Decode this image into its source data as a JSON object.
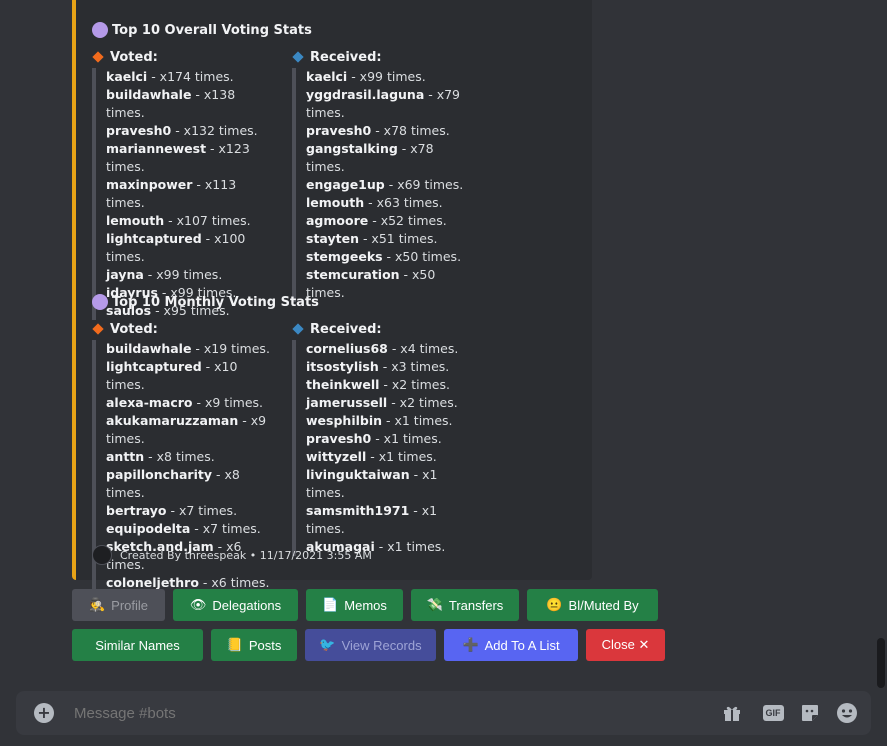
{
  "overall": {
    "title": "Top 10 Overall Voting Stats",
    "voted_label": "Voted:",
    "received_label": "Received:",
    "voted": [
      {
        "name": "kaelci",
        "count": " - x174 times."
      },
      {
        "name": "buildawhale",
        "count": " - x138 times."
      },
      {
        "name": "pravesh0",
        "count": " - x132 times."
      },
      {
        "name": "mariannewest",
        "count": " - x123 times."
      },
      {
        "name": "maxinpower",
        "count": " - x113 times."
      },
      {
        "name": "lemouth",
        "count": " - x107 times."
      },
      {
        "name": "lightcaptured",
        "count": " - x100 times."
      },
      {
        "name": "jayna",
        "count": " - x99 times."
      },
      {
        "name": "idayrus",
        "count": " - x99 times."
      },
      {
        "name": "saulos",
        "count": " - x95 times."
      }
    ],
    "received": [
      {
        "name": "kaelci",
        "count": " - x99 times."
      },
      {
        "name": "yggdrasil.laguna",
        "count": " - x79"
      },
      {
        "name": "",
        "count": "times."
      },
      {
        "name": "pravesh0",
        "count": " - x78 times."
      },
      {
        "name": "gangstalking",
        "count": " - x78 times."
      },
      {
        "name": "engage1up",
        "count": " - x69 times."
      },
      {
        "name": "lemouth",
        "count": " - x63 times."
      },
      {
        "name": "agmoore",
        "count": " - x52 times."
      },
      {
        "name": "stayten",
        "count": " - x51 times."
      },
      {
        "name": "stemgeeks",
        "count": " - x50 times."
      },
      {
        "name": "stemcuration",
        "count": " - x50 times."
      }
    ]
  },
  "monthly": {
    "title": "Top 10 Monthly Voting Stats",
    "voted_label": "Voted:",
    "received_label": "Received:",
    "voted": [
      {
        "name": "buildawhale",
        "count": " - x19 times."
      },
      {
        "name": "lightcaptured",
        "count": " - x10 times."
      },
      {
        "name": "alexa-macro",
        "count": " - x9 times."
      },
      {
        "name": "akukamaruzzaman",
        "count": " - x9"
      },
      {
        "name": "",
        "count": "times."
      },
      {
        "name": "anttn",
        "count": " - x8 times."
      },
      {
        "name": "papilloncharity",
        "count": " - x8 times."
      },
      {
        "name": "bertrayo",
        "count": " - x7 times."
      },
      {
        "name": "equipodelta",
        "count": " - x7 times."
      },
      {
        "name": "sketch.and.jam",
        "count": " - x6 times."
      },
      {
        "name": "coloneljethro",
        "count": " - x6 times."
      }
    ],
    "received": [
      {
        "name": "cornelius68",
        "count": " - x4 times."
      },
      {
        "name": "itsostylish",
        "count": " - x3 times."
      },
      {
        "name": "theinkwell",
        "count": " - x2 times."
      },
      {
        "name": "jamerussell",
        "count": " - x2 times."
      },
      {
        "name": "wesphilbin",
        "count": " - x1 times."
      },
      {
        "name": "pravesh0",
        "count": " - x1 times."
      },
      {
        "name": "wittyzell",
        "count": " - x1 times."
      },
      {
        "name": "livinguktaiwan",
        "count": " - x1 times."
      },
      {
        "name": "samsmith1971",
        "count": " - x1 times."
      },
      {
        "name": "akumagai",
        "count": " - x1 times."
      }
    ]
  },
  "footer": {
    "text": "Created By threespeak • 11/17/2021 3:55 AM"
  },
  "buttons": {
    "profile": "Profile",
    "delegations": "Delegations",
    "memos": "Memos",
    "transfers": "Transfers",
    "blmuted": "Bl/Muted By",
    "similar": "Similar Names",
    "posts": "Posts",
    "view_records": "View Records",
    "add_list": "Add To A List",
    "close": "Close ✕"
  },
  "composer": {
    "placeholder": "Message #bots",
    "gif_label": "GIF"
  },
  "colors": {
    "accent_bar": "#e8a317",
    "green": "#248046",
    "blurple": "#5865f2",
    "red": "#da373c"
  }
}
